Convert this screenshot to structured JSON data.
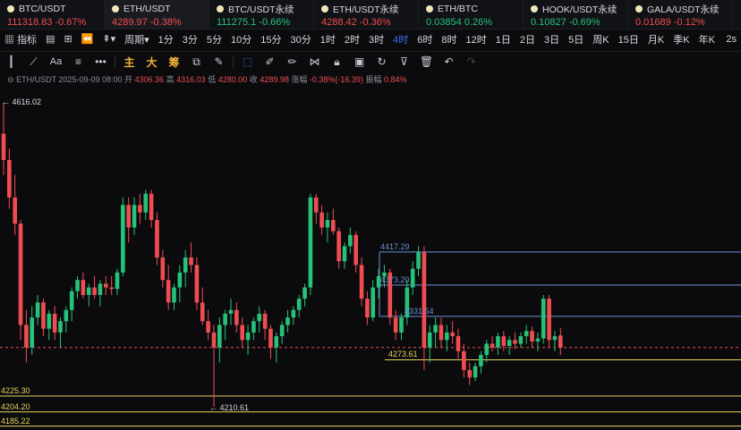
{
  "tabs": [
    {
      "name": "BTC/USDT",
      "price": "111318.83",
      "change": "-0.67%",
      "dir": "neg"
    },
    {
      "name": "ETH/USDT",
      "price": "4289.97",
      "change": "-0.38%",
      "dir": "neg"
    },
    {
      "name": "BTC/USDT永续",
      "price": "111275.1",
      "change": "-0.66%",
      "dir": "pos"
    },
    {
      "name": "ETH/USDT永续",
      "price": "4288.42",
      "change": "-0.36%",
      "dir": "neg"
    },
    {
      "name": "ETH/BTC",
      "price": "0.03854",
      "change": "0.26%",
      "dir": "pos"
    },
    {
      "name": "HOOK/USDT永续",
      "price": "0.10827",
      "change": "-0.69%",
      "dir": "pos"
    },
    {
      "name": "GALA/USDT永续",
      "price": "0.01689",
      "change": "-0.12%",
      "dir": "neg"
    }
  ],
  "toolbar": {
    "indicator": "指标",
    "period": "周期",
    "intervals": [
      "1分",
      "3分",
      "5分",
      "10分",
      "15分",
      "30分",
      "1时",
      "2时",
      "3时",
      "4时",
      "6时",
      "8时",
      "12时",
      "1日",
      "2日",
      "3日",
      "5日",
      "周K",
      "15日",
      "月K",
      "季K",
      "年K"
    ],
    "active_interval": "4时",
    "last": "2s",
    "draw_cn": [
      "主",
      "大",
      "筹"
    ]
  },
  "info": {
    "pair": "ETH/USDT",
    "time": "2025-09-09 08:00",
    "open_label": "开",
    "open": "4306.36",
    "high_label": "高",
    "high": "4316.03",
    "low_label": "低",
    "low": "4280.00",
    "close_label": "收",
    "close": "4289.98",
    "chg_label": "涨幅",
    "chg": "-0.38%(-16.39)",
    "amp_label": "振幅",
    "amp": "0.84%"
  },
  "chart_data": {
    "type": "candlestick",
    "up_color": "#26c27a",
    "down_color": "#f04d52",
    "price_range": [
      4180,
      4640
    ],
    "candles": [
      [
        4575,
        4616,
        4520,
        4540
      ],
      [
        4540,
        4555,
        4475,
        4490
      ],
      [
        4490,
        4520,
        4440,
        4455
      ],
      [
        4455,
        4460,
        4300,
        4320
      ],
      [
        4320,
        4340,
        4270,
        4290
      ],
      [
        4290,
        4345,
        4280,
        4330
      ],
      [
        4330,
        4360,
        4320,
        4350
      ],
      [
        4350,
        4355,
        4305,
        4315
      ],
      [
        4315,
        4340,
        4300,
        4335
      ],
      [
        4335,
        4345,
        4300,
        4310
      ],
      [
        4310,
        4330,
        4290,
        4325
      ],
      [
        4325,
        4345,
        4310,
        4340
      ],
      [
        4340,
        4370,
        4325,
        4365
      ],
      [
        4365,
        4385,
        4355,
        4380
      ],
      [
        4380,
        4390,
        4355,
        4360
      ],
      [
        4360,
        4375,
        4345,
        4370
      ],
      [
        4370,
        4385,
        4355,
        4360
      ],
      [
        4360,
        4380,
        4345,
        4375
      ],
      [
        4375,
        4385,
        4360,
        4370
      ],
      [
        4370,
        4385,
        4360,
        4368
      ],
      [
        4368,
        4395,
        4360,
        4390
      ],
      [
        4390,
        4490,
        4385,
        4480
      ],
      [
        4480,
        4490,
        4430,
        4450
      ],
      [
        4450,
        4490,
        4440,
        4480
      ],
      [
        4480,
        4495,
        4455,
        4470
      ],
      [
        4470,
        4500,
        4460,
        4495
      ],
      [
        4495,
        4500,
        4450,
        4460
      ],
      [
        4460,
        4470,
        4400,
        4410
      ],
      [
        4410,
        4420,
        4370,
        4380
      ],
      [
        4380,
        4400,
        4340,
        4350
      ],
      [
        4350,
        4375,
        4340,
        4370
      ],
      [
        4370,
        4400,
        4350,
        4390
      ],
      [
        4390,
        4420,
        4370,
        4410
      ],
      [
        4410,
        4430,
        4390,
        4400
      ],
      [
        4400,
        4410,
        4340,
        4350
      ],
      [
        4350,
        4370,
        4320,
        4325
      ],
      [
        4325,
        4340,
        4300,
        4310
      ],
      [
        4310,
        4320,
        4211,
        4290
      ],
      [
        4290,
        4330,
        4270,
        4320
      ],
      [
        4320,
        4340,
        4300,
        4335
      ],
      [
        4335,
        4355,
        4320,
        4340
      ],
      [
        4340,
        4350,
        4310,
        4320
      ],
      [
        4320,
        4330,
        4290,
        4300
      ],
      [
        4300,
        4320,
        4280,
        4310
      ],
      [
        4310,
        4330,
        4300,
        4325
      ],
      [
        4325,
        4345,
        4310,
        4335
      ],
      [
        4335,
        4340,
        4300,
        4315
      ],
      [
        4315,
        4320,
        4275,
        4290
      ],
      [
        4290,
        4310,
        4270,
        4305
      ],
      [
        4305,
        4325,
        4295,
        4320
      ],
      [
        4320,
        4340,
        4310,
        4330
      ],
      [
        4330,
        4345,
        4320,
        4340
      ],
      [
        4340,
        4360,
        4330,
        4355
      ],
      [
        4355,
        4375,
        4345,
        4370
      ],
      [
        4370,
        4495,
        4360,
        4490
      ],
      [
        4490,
        4495,
        4455,
        4470
      ],
      [
        4470,
        4480,
        4440,
        4450
      ],
      [
        4450,
        4470,
        4430,
        4460
      ],
      [
        4460,
        4475,
        4440,
        4445
      ],
      [
        4445,
        4450,
        4395,
        4405
      ],
      [
        4405,
        4430,
        4395,
        4425
      ],
      [
        4425,
        4450,
        4415,
        4440
      ],
      [
        4440,
        4445,
        4390,
        4400
      ],
      [
        4400,
        4410,
        4345,
        4355
      ],
      [
        4355,
        4365,
        4320,
        4330
      ],
      [
        4330,
        4380,
        4325,
        4370
      ],
      [
        4370,
        4395,
        4355,
        4385
      ],
      [
        4385,
        4400,
        4370,
        4390
      ],
      [
        4390,
        4395,
        4320,
        4330
      ],
      [
        4330,
        4340,
        4300,
        4310
      ],
      [
        4310,
        4335,
        4300,
        4330
      ],
      [
        4330,
        4380,
        4320,
        4370
      ],
      [
        4370,
        4405,
        4360,
        4395
      ],
      [
        4395,
        4425,
        4385,
        4417
      ],
      [
        4417,
        4425,
        4260,
        4290
      ],
      [
        4290,
        4320,
        4270,
        4310
      ],
      [
        4310,
        4330,
        4290,
        4320
      ],
      [
        4320,
        4330,
        4290,
        4300
      ],
      [
        4300,
        4320,
        4285,
        4310
      ],
      [
        4310,
        4325,
        4295,
        4305
      ],
      [
        4305,
        4315,
        4275,
        4285
      ],
      [
        4285,
        4295,
        4250,
        4260
      ],
      [
        4260,
        4270,
        4240,
        4250
      ],
      [
        4250,
        4270,
        4245,
        4265
      ],
      [
        4265,
        4285,
        4255,
        4280
      ],
      [
        4280,
        4300,
        4270,
        4295
      ],
      [
        4295,
        4305,
        4285,
        4290
      ],
      [
        4290,
        4310,
        4280,
        4305
      ],
      [
        4305,
        4312,
        4285,
        4292
      ],
      [
        4292,
        4305,
        4280,
        4300
      ],
      [
        4300,
        4310,
        4288,
        4295
      ],
      [
        4295,
        4310,
        4290,
        4305
      ],
      [
        4305,
        4320,
        4295,
        4312
      ],
      [
        4312,
        4318,
        4290,
        4298
      ],
      [
        4298,
        4310,
        4285,
        4302
      ],
      [
        4302,
        4360,
        4295,
        4355
      ],
      [
        4355,
        4360,
        4290,
        4300
      ],
      [
        4300,
        4312,
        4285,
        4305
      ],
      [
        4306,
        4316,
        4280,
        4290
      ]
    ],
    "levels": [
      {
        "label": "4417.29",
        "value": 4417.29,
        "color": "#6b8fd6"
      },
      {
        "label": "4373.20",
        "value": 4373.2,
        "color": "#6b8fd6"
      },
      {
        "label": "4331.54",
        "value": 4331.54,
        "color": "#6b8fd6"
      },
      {
        "label": "4273.61",
        "value": 4273.61,
        "color": "#e6d35a"
      },
      {
        "label": "4225.30",
        "value": 4225.3,
        "color": "#e6d35a"
      },
      {
        "label": "4204.20",
        "value": 4204.2,
        "color": "#e6d35a"
      },
      {
        "label": "4185.22",
        "value": 4185.22,
        "color": "#e6d35a"
      }
    ],
    "current_price": 4289.98,
    "high_marker": "← 4616.02",
    "low_marker": "← 4210.61"
  }
}
